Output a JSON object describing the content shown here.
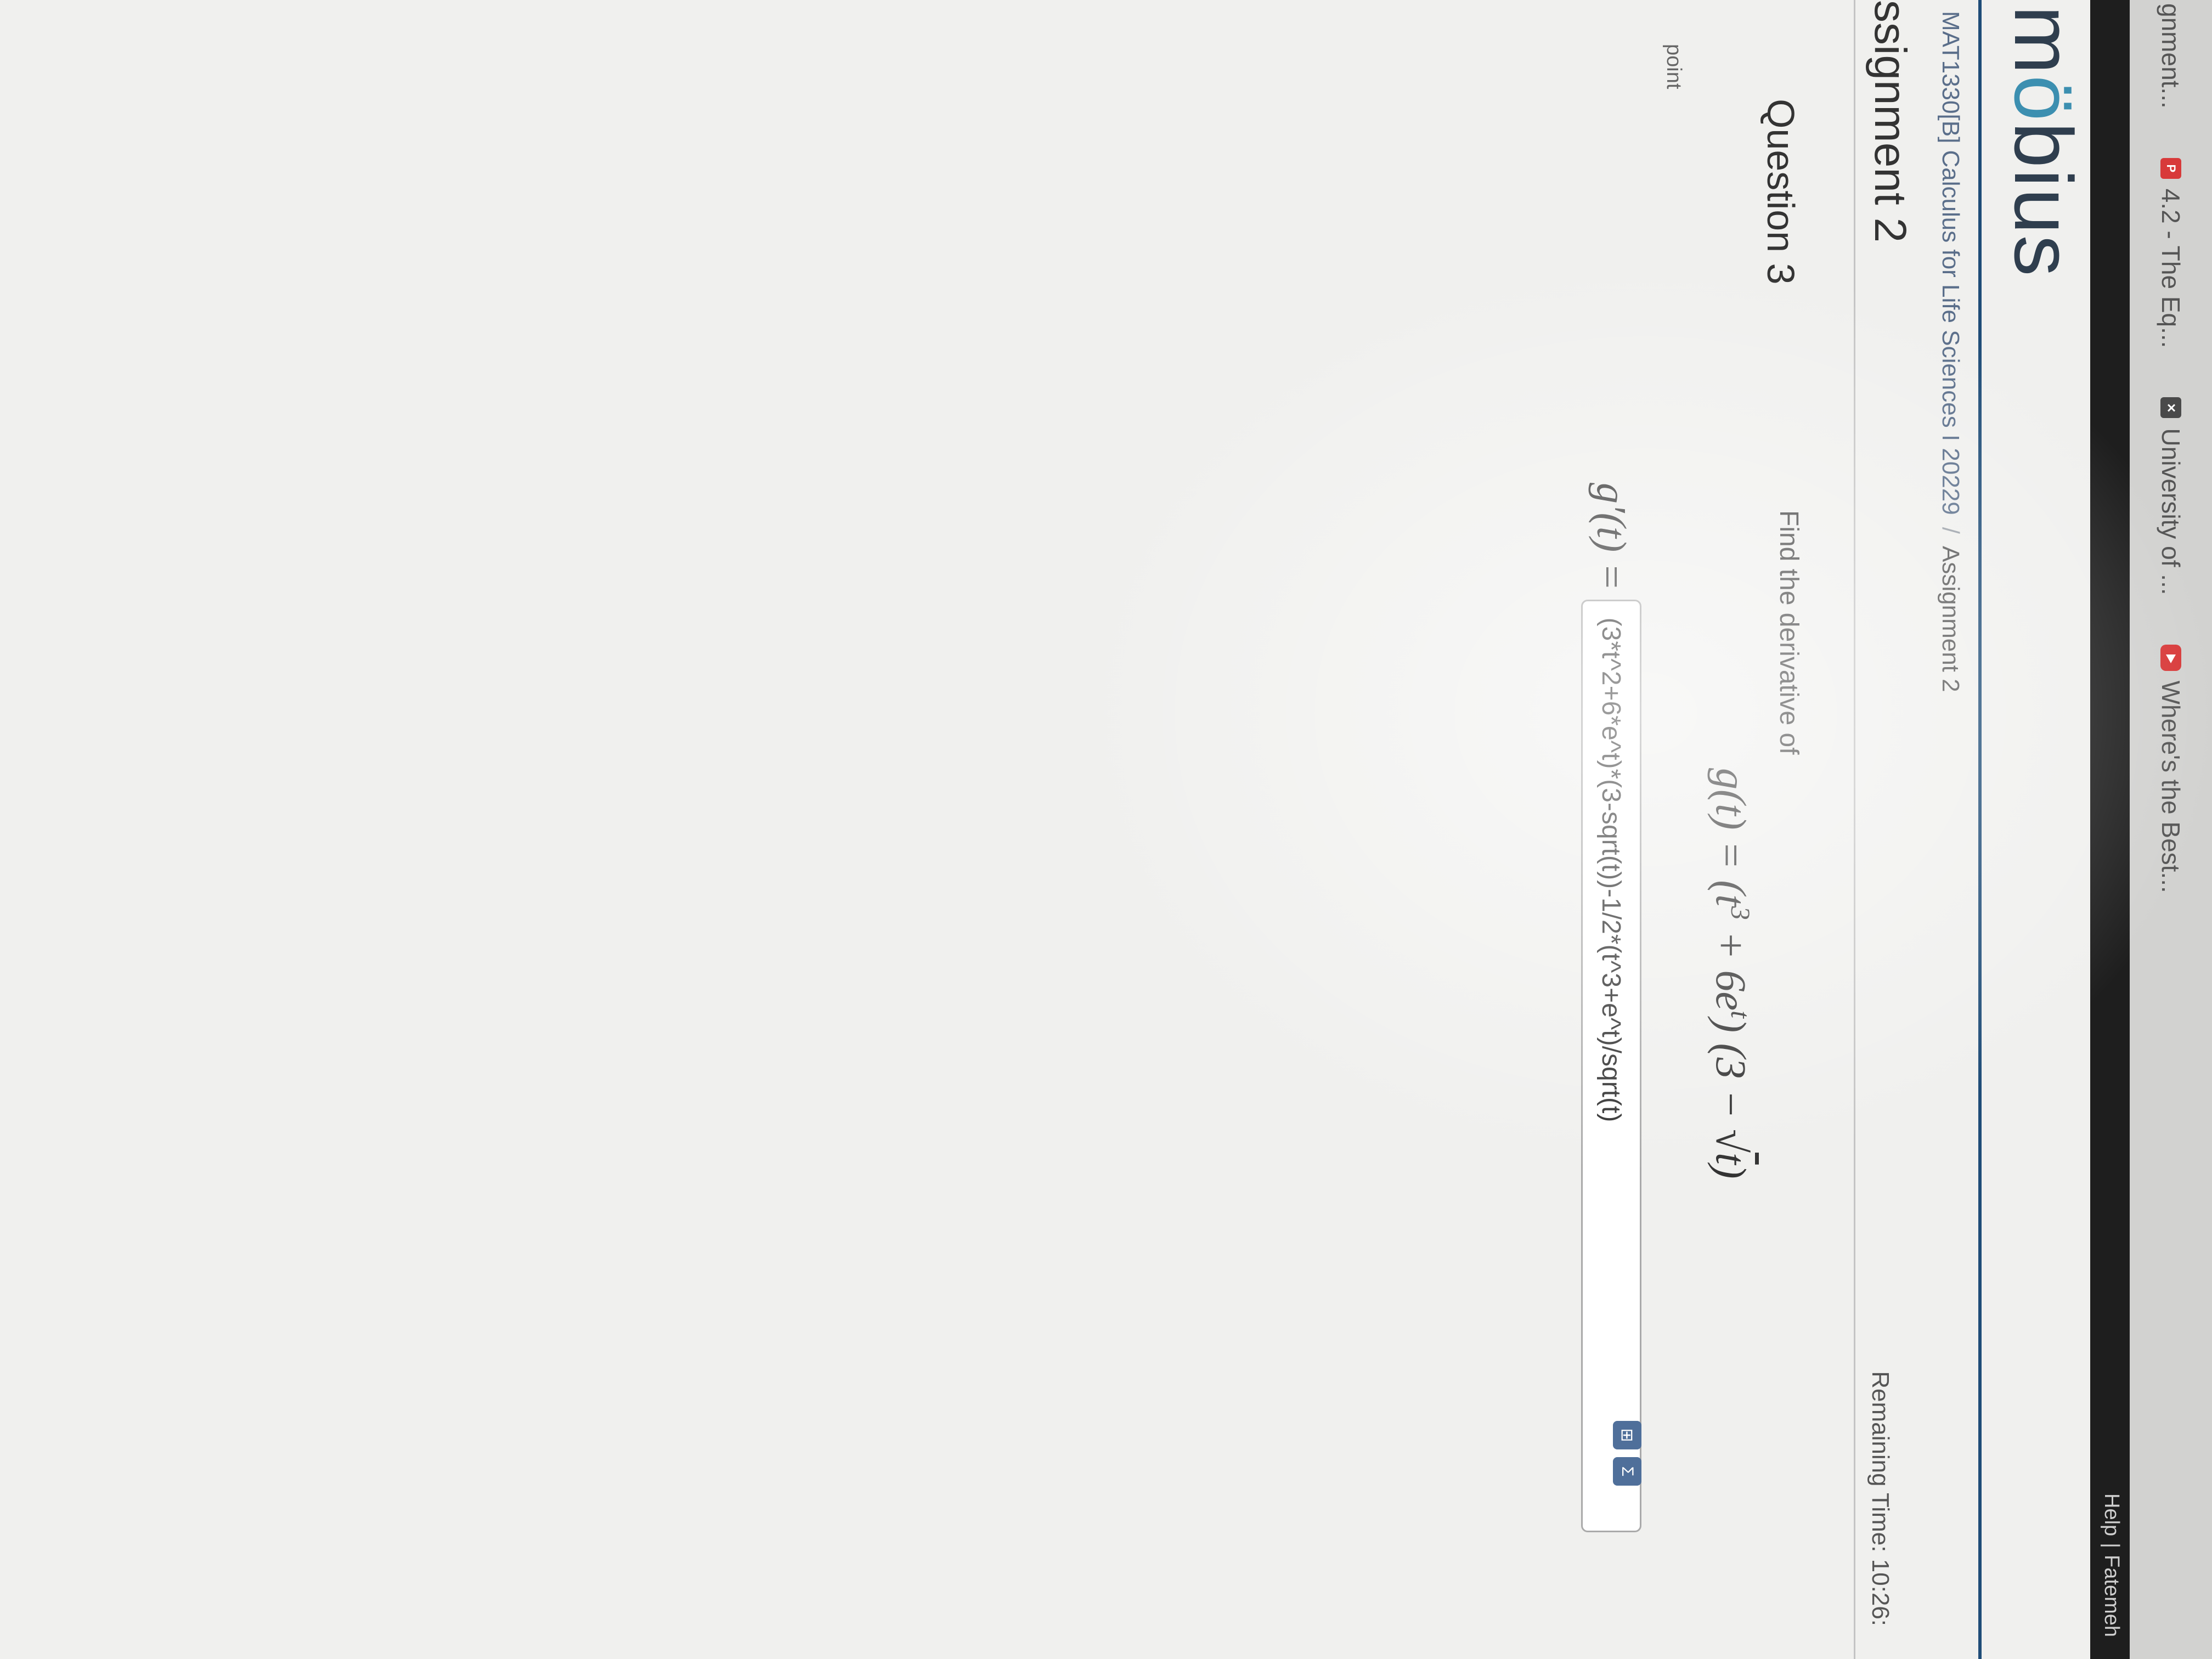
{
  "browser": {
    "tabs": [
      {
        "label": "gnment...",
        "icon": "none"
      },
      {
        "label": "4.2 - The Eq...",
        "icon": "pdf-icon"
      },
      {
        "label": "University of ...",
        "icon": "app-icon"
      },
      {
        "label": "Where's the Best...",
        "icon": "video-icon"
      }
    ]
  },
  "menu": {
    "help": "Help",
    "separator": "|",
    "user": "Fatemeh"
  },
  "logo": {
    "text_start": "m",
    "text_mark": "ö",
    "text_end": "bius"
  },
  "breadcrumb": {
    "course": "MAT1330[B] Calculus for Life Sciences I 20229",
    "separator": "/",
    "assignment": "Assignment 2"
  },
  "page_title": "ssignment 2",
  "remaining_time": {
    "label": "Remaining Time:",
    "value": "10:26:"
  },
  "question": {
    "number_label": "Question 3",
    "points_label": "point",
    "prompt": "Find the derivative of",
    "function": {
      "lhs": "g(t) = (t",
      "exp1": "3",
      "mid": " + 6e",
      "exp2": "t",
      "mid2": ") (3 − ",
      "root": "√",
      "root_arg": "t",
      "tail": ")"
    },
    "answer_label": "g′(t) =",
    "answer_value": "(3*t^2+6*e^t)*(3-sqrt(t))-1/2*(t^3+e^t)/sqrt(t)"
  },
  "icons": {
    "preview": "preview-icon",
    "equation_editor": "equation-editor-icon"
  }
}
